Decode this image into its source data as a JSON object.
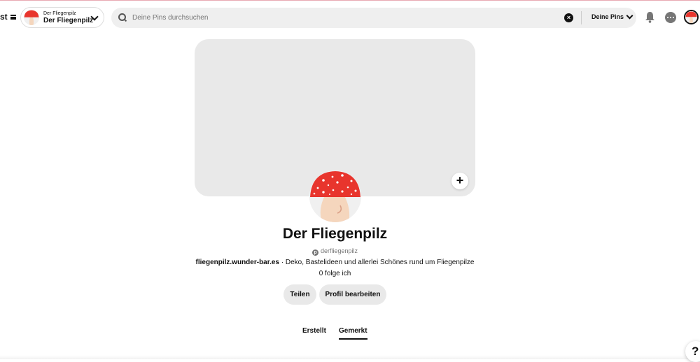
{
  "header": {
    "nav_cut_text": "st",
    "account_switcher": {
      "small_label": "Der Fliegenpilz",
      "name": "Der Fliegenpilz"
    },
    "search": {
      "placeholder": "Deine Pins durchsuchen",
      "value": "",
      "scope_label": "Deine Pins"
    },
    "icons": [
      "menu-icon",
      "mushroom-avatar",
      "chevron-down-icon",
      "search-icon",
      "clear-icon",
      "bell-icon",
      "chat-icon",
      "avatar"
    ]
  },
  "profile": {
    "name": "Der Fliegenpilz",
    "handle": "derfliegenpilz",
    "website": "fliegenpilz.wunder-bar.es",
    "bio_separator": " · ",
    "bio": "Deko, Bastelideen und allerlei Schönes rund um Fliegenpilze",
    "following": "0 folge ich",
    "add_cover_label": "+"
  },
  "actions": {
    "share": "Teilen",
    "edit_profile": "Profil bearbeiten"
  },
  "tabs": [
    {
      "label": "Erstellt",
      "active": false
    },
    {
      "label": "Gemerkt",
      "active": true
    }
  ],
  "help_label": "?",
  "colors": {
    "mushroom_cap": "#e8352d",
    "mushroom_stem": "#f5d6bd",
    "cover_bg": "#e9e9e9",
    "button_bg": "#e9e9e9",
    "search_bg": "#efefef"
  }
}
